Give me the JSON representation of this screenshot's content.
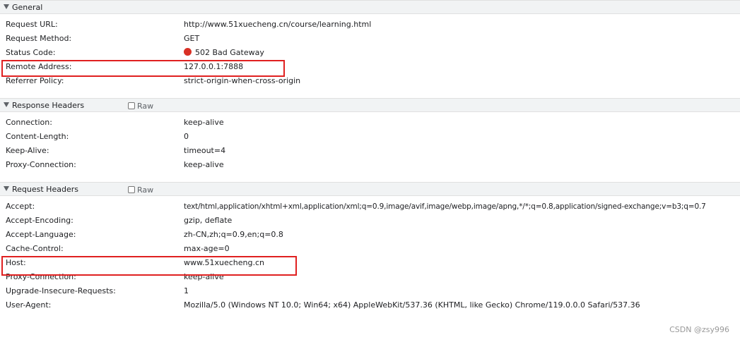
{
  "general": {
    "title": "General",
    "rows": [
      {
        "key": "Request URL:",
        "value": "http://www.51xuecheng.cn/course/learning.html"
      },
      {
        "key": "Request Method:",
        "value": "GET"
      },
      {
        "key": "Status Code:",
        "value": "502 Bad Gateway"
      },
      {
        "key": "Remote Address:",
        "value": "127.0.0.1:7888"
      },
      {
        "key": "Referrer Policy:",
        "value": "strict-origin-when-cross-origin"
      }
    ]
  },
  "response_headers": {
    "title": "Response Headers",
    "raw_label": "Raw",
    "rows": [
      {
        "key": "Connection:",
        "value": "keep-alive"
      },
      {
        "key": "Content-Length:",
        "value": "0"
      },
      {
        "key": "Keep-Alive:",
        "value": "timeout=4"
      },
      {
        "key": "Proxy-Connection:",
        "value": "keep-alive"
      }
    ]
  },
  "request_headers": {
    "title": "Request Headers",
    "raw_label": "Raw",
    "rows": [
      {
        "key": "Accept:",
        "value": "text/html,application/xhtml+xml,application/xml;q=0.9,image/avif,image/webp,image/apng,*/*;q=0.8,application/signed-exchange;v=b3;q=0.7"
      },
      {
        "key": "Accept-Encoding:",
        "value": "gzip, deflate"
      },
      {
        "key": "Accept-Language:",
        "value": "zh-CN,zh;q=0.9,en;q=0.8"
      },
      {
        "key": "Cache-Control:",
        "value": "max-age=0"
      },
      {
        "key": "Host:",
        "value": "www.51xuecheng.cn"
      },
      {
        "key": "Proxy-Connection:",
        "value": "keep-alive"
      },
      {
        "key": "Upgrade-Insecure-Requests:",
        "value": "1"
      },
      {
        "key": "User-Agent:",
        "value": "Mozilla/5.0 (Windows NT 10.0; Win64; x64) AppleWebKit/537.36 (KHTML, like Gecko) Chrome/119.0.0.0 Safari/537.36"
      }
    ]
  },
  "colors": {
    "status_error": "#d93025",
    "highlight_box": "#e02020"
  },
  "watermark": "CSDN @zsy996"
}
